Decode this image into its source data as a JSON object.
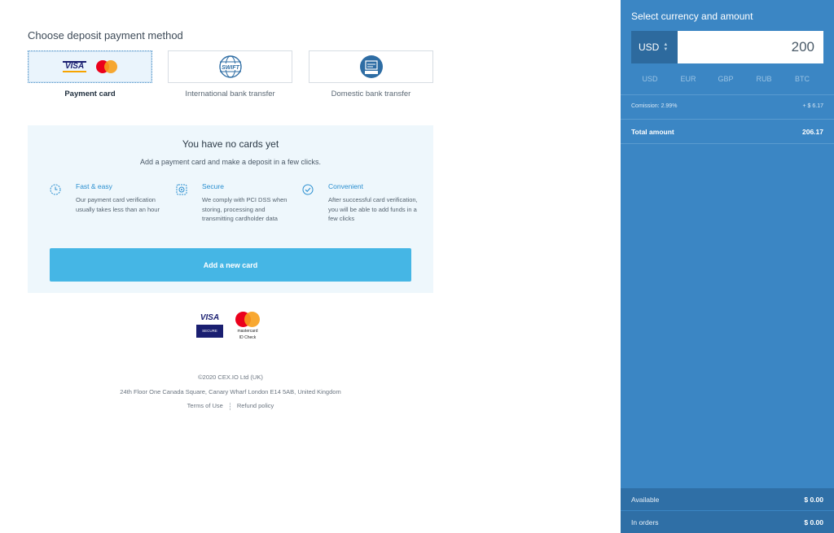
{
  "main": {
    "section_title": "Choose deposit payment method",
    "methods": [
      {
        "label": "Payment card",
        "icon": "visa-mastercard-icon",
        "active": true
      },
      {
        "label": "International bank transfer",
        "icon": "swift-globe-icon",
        "active": false
      },
      {
        "label": "Domestic bank transfer",
        "icon": "bank-transfer-icon",
        "active": false
      }
    ],
    "cards_box": {
      "title": "You have no cards yet",
      "subtitle": "Add a payment card and make a deposit in a few clicks.",
      "features": [
        {
          "title": "Fast & easy",
          "text": "Our payment card verification usually takes less than an hour",
          "icon": "clock-icon"
        },
        {
          "title": "Secure",
          "text": "We comply with PCI DSS when storing, processing and transmitting cardholder data",
          "icon": "shield-icon"
        },
        {
          "title": "Convenient",
          "text": "After successful card verification, you will be able to add funds in a few clicks",
          "icon": "check-circle-icon"
        }
      ],
      "add_button": "Add a new card"
    },
    "badges": {
      "visa": "VISA",
      "visa_secure": "SECURE",
      "mc_line1": "mastercard",
      "mc_line2": "ID Check"
    },
    "footer": {
      "copyright": "©2020 CEX.IO Ltd (UK)",
      "address": "24th Floor One Canada Square, Canary Wharf London E14 5AB, United Kingdom",
      "terms": "Terms of Use",
      "refund": "Refund policy"
    }
  },
  "panel": {
    "title": "Select currency and amount",
    "currency": "USD",
    "amount": "200",
    "currencies": [
      "USD",
      "EUR",
      "GBP",
      "RUB",
      "BTC"
    ],
    "commission_label": "Comission: 2.99%",
    "commission_value": "+ $ 6.17",
    "total_label": "Total amount",
    "total_value": "206.17",
    "available_label": "Available",
    "available_value": "$ 0.00",
    "in_orders_label": "In orders",
    "in_orders_value": "$ 0.00"
  },
  "colors": {
    "panel": "#3b86c4",
    "accent_button": "#45b6e5",
    "cards_box_bg": "#eef7fc"
  }
}
